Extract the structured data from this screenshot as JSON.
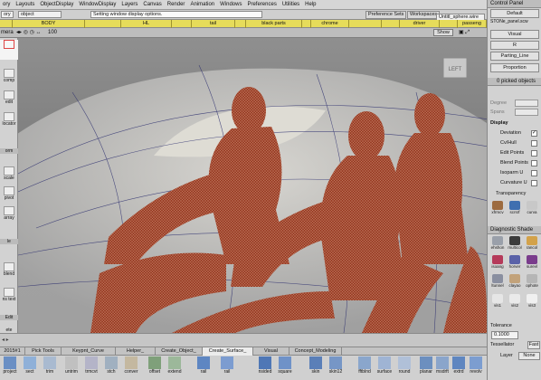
{
  "menu": [
    "ory",
    "Layouts",
    "ObjectDisplay",
    "WindowDisplay",
    "Layers",
    "Canvas",
    "Render",
    "Animation",
    "Windows",
    "Preferences",
    "Utilities",
    "Help"
  ],
  "toolbar": {
    "object_field": "object",
    "status_text": "Setting window display options.",
    "preference_sets": "Preference Sets",
    "workspaces": "Workspaces",
    "workspace_value": "Untitl_sphere.wire"
  },
  "layers": [
    "",
    "BODY",
    "",
    "HL",
    "",
    "tail",
    "",
    "black parts",
    "",
    "chrome",
    "",
    "",
    "driver",
    "",
    "passeng"
  ],
  "viewport": {
    "camera_label": "mera",
    "zoom_value": "100",
    "show_button": "Show",
    "cube_label": "LEFT"
  },
  "left_tools": [
    "comp",
    "edit",
    "locator",
    "orm",
    "scale",
    "pivot",
    "array",
    "le",
    "blend",
    "ns text",
    "Edit",
    "ete"
  ],
  "shelf_tabs": [
    "2015#1",
    "Pick Tools",
    "Keypnt_Curve",
    "Helper_",
    "Create_Object_",
    "Create_Surface_",
    "Visual",
    "Concept_Modeling"
  ],
  "shelf_active": "Create_Surface_",
  "shelf_items": [
    "project",
    "sect",
    "trim",
    "untrim",
    "trmcvt",
    "stch",
    "conver",
    "offset",
    "extend",
    "rail",
    "rail",
    "nsided",
    "square",
    "skin",
    "skin12",
    "fftblnd",
    "surface",
    "round",
    "planar",
    "msdrft",
    "extrd",
    "revolv"
  ],
  "right_panel": {
    "control_panel": "Control Panel",
    "default": "Default",
    "file": "STONe_panel.scw",
    "buttons": [
      "Visual",
      "R",
      "Parting_Line",
      "Proportion"
    ],
    "picked": "0 picked objects",
    "degree_label": "Degree",
    "spans_label": "Spans",
    "display_title": "Display",
    "display_items": [
      {
        "label": "Deviation",
        "checked": true
      },
      {
        "label": "Cv/Hull",
        "checked": false
      },
      {
        "label": "Edit Points",
        "checked": false
      },
      {
        "label": "Blend Points",
        "checked": false
      },
      {
        "label": "Isoparm U",
        "checked": false
      },
      {
        "label": "Curvature U",
        "checked": false
      }
    ],
    "transparency": "Transparency",
    "icon_labels": [
      "xfrmcv",
      "scrsrf",
      "curva"
    ],
    "diagnostic_title": "Diagnostic Shade",
    "diag_labels": [
      "ehshon",
      "multicol",
      "rancol",
      "isoang",
      "horver",
      "surevl",
      "ltunnel",
      "clayao",
      "ophote",
      "vis1",
      "vis2",
      "vis3"
    ],
    "tolerance_label": "Tolerance",
    "tolerance_value": "0.1000",
    "tessellator_label": "Tessellator",
    "tessellator_value": "Fast",
    "layer_label": "Layer",
    "layer_value": "None"
  },
  "colors": {
    "mesh": "#a0412a",
    "layer_bar": "#e6dc5a",
    "viewport_bg": "#8a8a8a"
  }
}
